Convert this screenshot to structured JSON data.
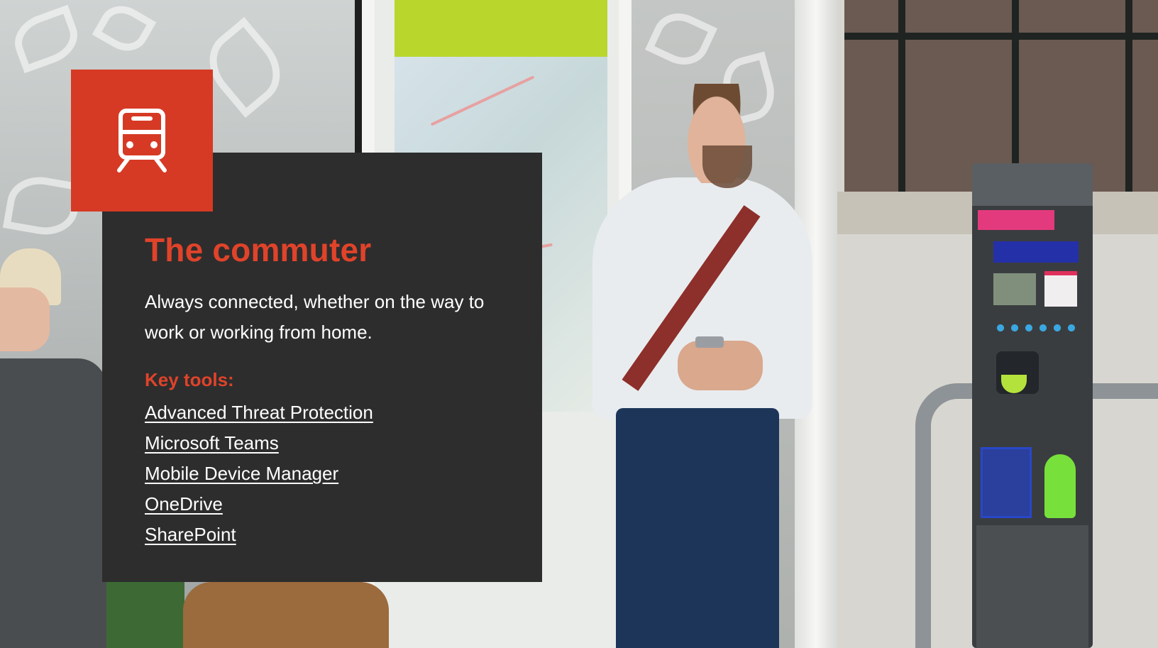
{
  "slide": {
    "icon": "train-icon",
    "title": "The commuter",
    "description": "Always connected, whether on the way to work or working from home.",
    "key_tools_heading": "Key tools:",
    "key_tools": [
      "Advanced Threat Protection",
      "Microsoft Teams",
      "Mobile Device Manager",
      "OneDrive",
      "SharePoint"
    ]
  },
  "colors": {
    "accent": "#d63a24",
    "accent_text": "#e0432a",
    "panel": "#2d2d2d",
    "text": "#ffffff"
  },
  "background_image": "commuters at transit stop with parking meter"
}
